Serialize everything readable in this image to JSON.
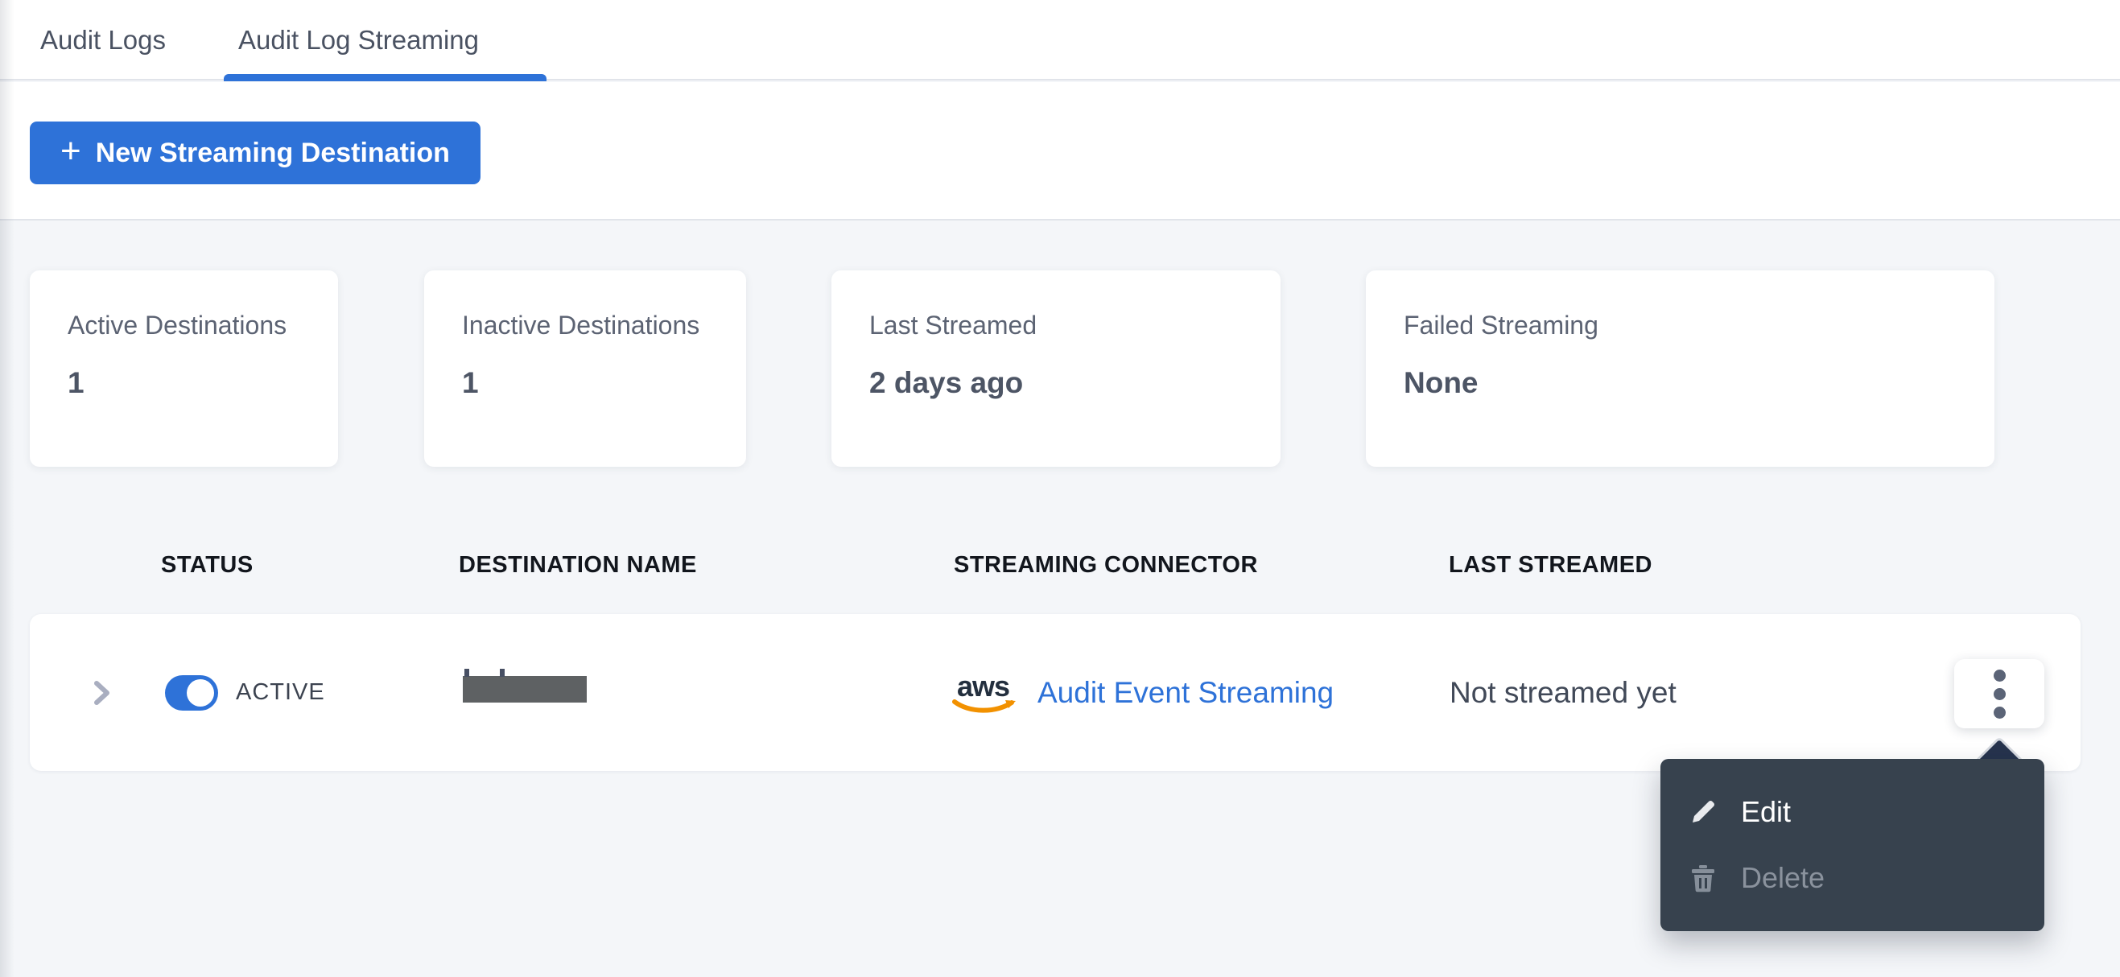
{
  "tabs": {
    "audit_logs": "Audit Logs",
    "audit_log_streaming": "Audit Log Streaming"
  },
  "toolbar": {
    "plus_icon": "+",
    "new_destination_label": "New Streaming Destination"
  },
  "stats": [
    {
      "label": "Active Destinations",
      "value": "1"
    },
    {
      "label": "Inactive Destinations",
      "value": "1"
    },
    {
      "label": "Last Streamed",
      "value": "2 days ago"
    },
    {
      "label": "Failed Streaming",
      "value": "None"
    }
  ],
  "table": {
    "headers": [
      "STATUS",
      "DESTINATION NAME",
      "STREAMING CONNECTOR",
      "LAST STREAMED"
    ],
    "row": {
      "status_label": "ACTIVE",
      "destination_name_redacted": "",
      "connector_brand": "aws",
      "connector_label": "Audit Event Streaming",
      "last_streamed": "Not streamed yet"
    }
  },
  "menu": {
    "edit_label": "Edit",
    "delete_label": "Delete"
  },
  "colors": {
    "accent_blue": "#2e72d8",
    "link_blue": "#2e72d8",
    "page_background": "#f4f6f9",
    "menu_background": "#37424e",
    "menu_arrow": "#26334d",
    "aws_navy": "#232f3e",
    "aws_orange": "#f29100",
    "redaction_gray": "#5e6163"
  }
}
